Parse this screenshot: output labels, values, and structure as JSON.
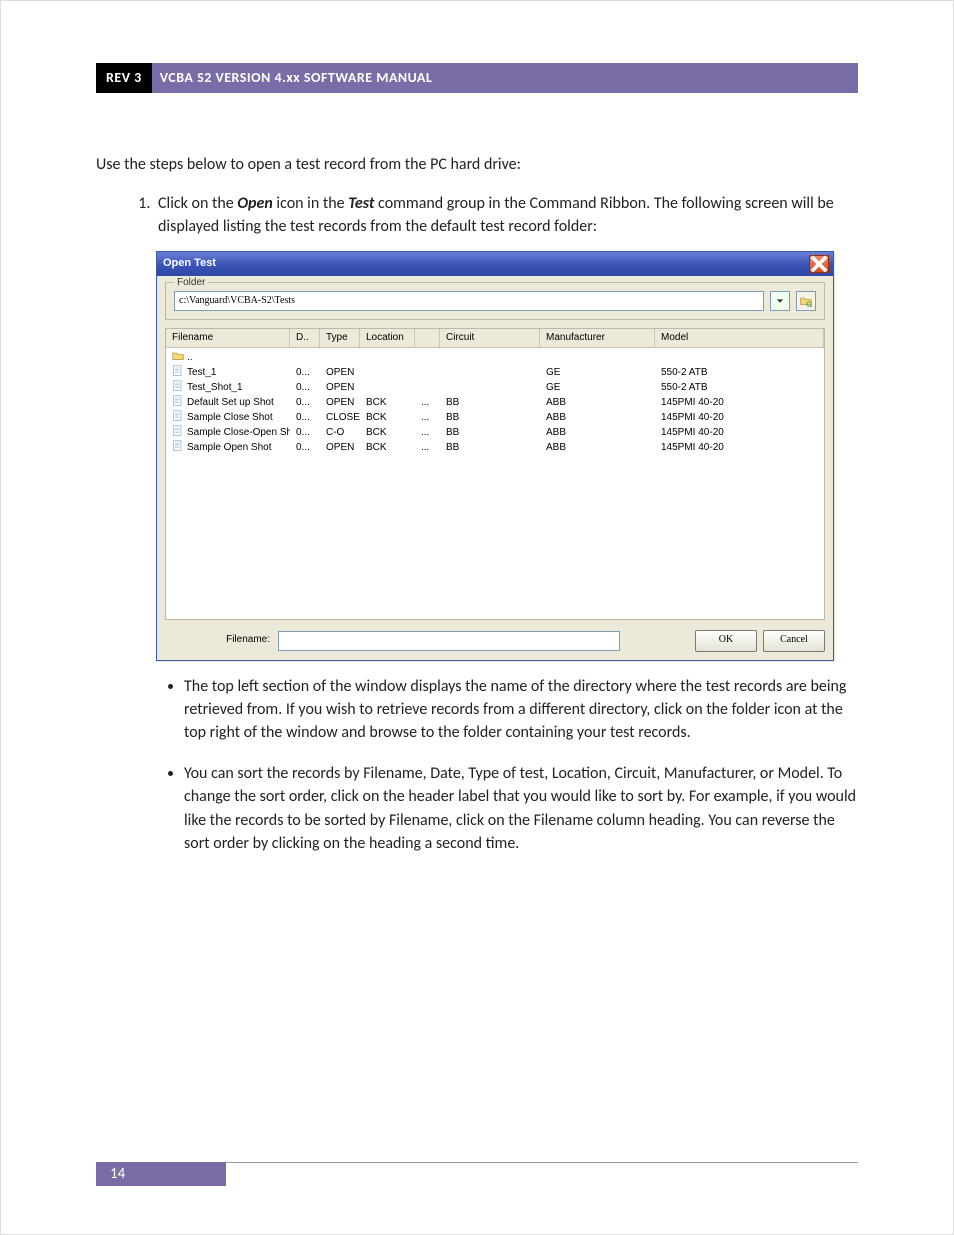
{
  "header": {
    "rev": "REV 3",
    "title": "VCBA S2 VERSION 4.xx SOFTWARE MANUAL"
  },
  "intro": "Use the steps below to open a test record from the PC hard drive:",
  "step1_pre": "Click on the ",
  "step1_open": "Open",
  "step1_mid": " icon in the ",
  "step1_test": "Test",
  "step1_post": " command group in the Command Ribbon. The following screen will be displayed listing the test records from the default test record folder:",
  "dialog": {
    "title": "Open Test",
    "folder_legend": "Folder",
    "folder_path": "c:\\Vanguard\\VCBA-S2\\Tests",
    "filename_label": "Filename:",
    "ok": "OK",
    "cancel": "Cancel",
    "headers": {
      "filename": "Filename",
      "date": "D..",
      "type": "Type",
      "location": "Location",
      "circuit": "Circuit",
      "manufacturer": "Manufacturer",
      "model": "Model"
    },
    "up_row": "..",
    "rows": [
      {
        "filename": "Test_1",
        "date": "0...",
        "type": "OPEN",
        "location": "",
        "loc2": "",
        "circuit": "",
        "manufacturer": "GE",
        "model": "550-2 ATB"
      },
      {
        "filename": "Test_Shot_1",
        "date": "0...",
        "type": "OPEN",
        "location": "",
        "loc2": "",
        "circuit": "",
        "manufacturer": "GE",
        "model": "550-2 ATB"
      },
      {
        "filename": "Default Set up Shot",
        "date": "0...",
        "type": "OPEN",
        "location": "BCK",
        "loc2": "...",
        "circuit": "BB",
        "manufacturer": "ABB",
        "model": "145PMI 40-20"
      },
      {
        "filename": "Sample Close Shot",
        "date": "0...",
        "type": "CLOSE",
        "location": "BCK",
        "loc2": "...",
        "circuit": "BB",
        "manufacturer": "ABB",
        "model": "145PMI 40-20"
      },
      {
        "filename": "Sample Close-Open Shot",
        "date": "0...",
        "type": "C-O",
        "location": "BCK",
        "loc2": "...",
        "circuit": "BB",
        "manufacturer": "ABB",
        "model": "145PMI 40-20"
      },
      {
        "filename": "Sample Open Shot",
        "date": "0...",
        "type": "OPEN",
        "location": "BCK",
        "loc2": "...",
        "circuit": "BB",
        "manufacturer": "ABB",
        "model": "145PMI 40-20"
      }
    ]
  },
  "bullets": [
    "The top left section of the window displays the name of the directory where the test records are being retrieved from. If you wish to retrieve records from a different directory, click on the folder icon at the top right of the window and browse to the folder containing your test records.",
    "You can sort the records by Filename, Date, Type of test, Location, Circuit, Manufacturer, or Model. To change the sort order, click on the header label that you would like to sort by. For example, if you would like the records to be sorted by Filename, click on the Filename column heading. You can reverse the sort order by clicking on the heading a second time."
  ],
  "page_number": "14"
}
